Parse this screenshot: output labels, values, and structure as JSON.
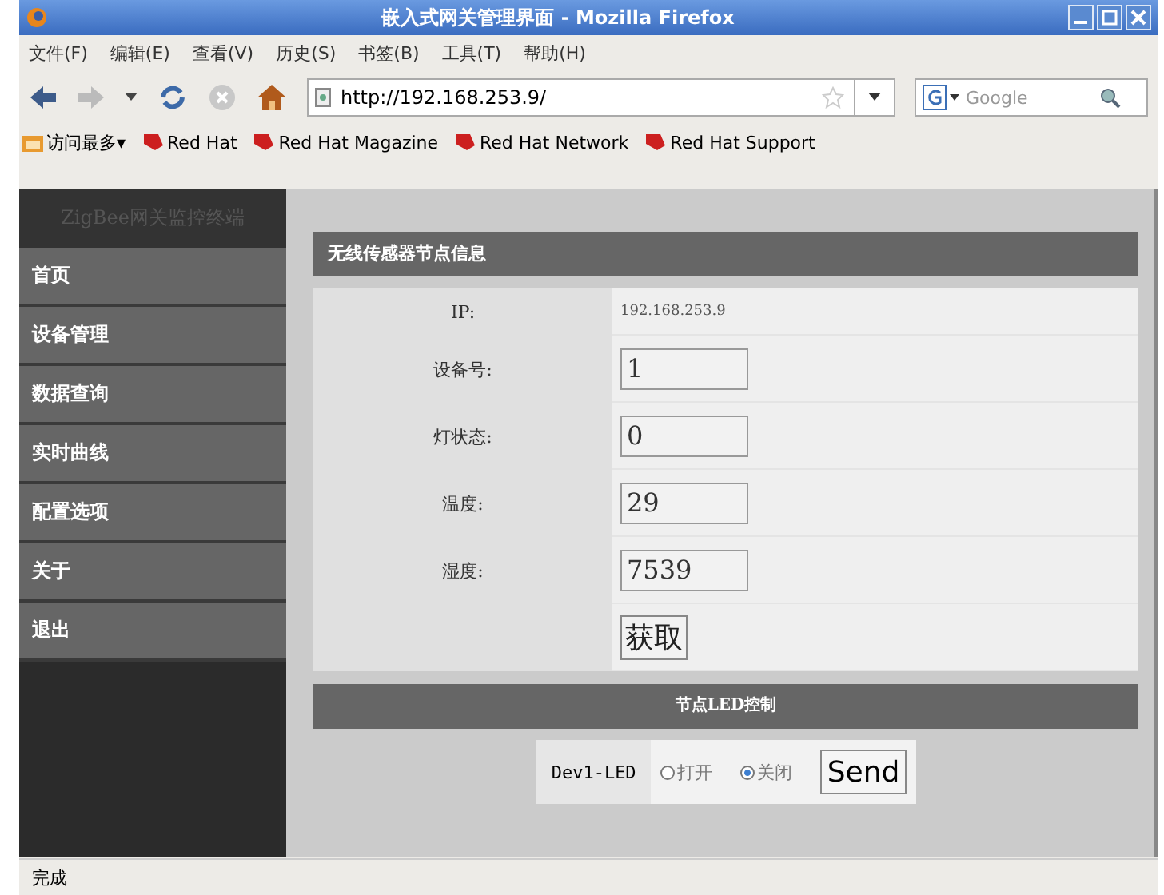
{
  "window": {
    "title": "嵌入式网关管理界面 - Mozilla Firefox"
  },
  "menu": [
    "文件(F)",
    "编辑(E)",
    "查看(V)",
    "历史(S)",
    "书签(B)",
    "工具(T)",
    "帮助(H)"
  ],
  "address": {
    "value": "http://192.168.253.9/"
  },
  "search": {
    "placeholder": "Google"
  },
  "bookmarks": [
    {
      "label": "访问最多▾",
      "kind": "folder"
    },
    {
      "label": "Red Hat",
      "kind": "link"
    },
    {
      "label": "Red Hat Magazine",
      "kind": "link"
    },
    {
      "label": "Red Hat Network",
      "kind": "link"
    },
    {
      "label": "Red Hat Support",
      "kind": "link"
    }
  ],
  "sidebar": {
    "title": "ZigBee网关监控终端",
    "items": [
      "首页",
      "设备管理",
      "数据查询",
      "实时曲线",
      "配置选项",
      "关于",
      "退出"
    ]
  },
  "panel": {
    "title": "无线传感器节点信息",
    "fields": [
      {
        "label": "IP:",
        "value": "192.168.253.9",
        "kind": "text"
      },
      {
        "label": "设备号:",
        "value": "1",
        "kind": "input"
      },
      {
        "label": "灯状态:",
        "value": "0",
        "kind": "input"
      },
      {
        "label": "温度:",
        "value": "29",
        "kind": "input"
      },
      {
        "label": "湿度:",
        "value": "7539",
        "kind": "input"
      }
    ],
    "button": "获取"
  },
  "led": {
    "title": "节点LED控制",
    "device": "Dev1-LED",
    "options": [
      {
        "label": "打开",
        "selected": false
      },
      {
        "label": "关闭",
        "selected": true
      }
    ],
    "button": "Send"
  },
  "status_bar": "完成"
}
